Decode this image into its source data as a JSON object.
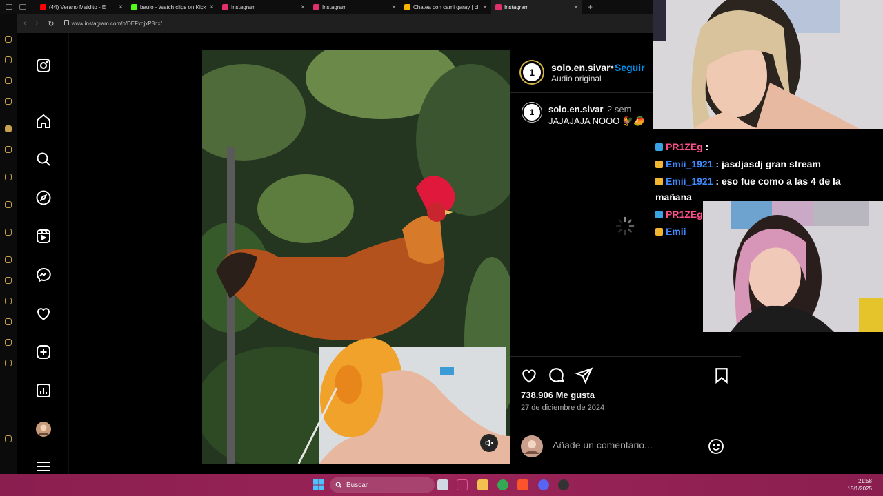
{
  "browser": {
    "tabs": [
      {
        "title": "(44) Verano Maldito - E",
        "favicon_color": "#ff0000"
      },
      {
        "title": "baulo - Watch clips on Kick",
        "favicon_color": "#53fc18"
      },
      {
        "title": "Instagram",
        "favicon_color": "#e1306c"
      },
      {
        "title": "Instagram",
        "favicon_color": "#e1306c"
      },
      {
        "title": "Chatea con cami garay | cl",
        "favicon_color": "#f7b500"
      },
      {
        "title": "Instagram",
        "favicon_color": "#e1306c"
      }
    ],
    "active_tab": 5,
    "url": "www.instagram.com/p/DEFxojxP8nx/"
  },
  "instagram": {
    "post": {
      "username": "solo.en.sivar",
      "follow_label": "Seguir",
      "separator": "•",
      "audio": "Audio original",
      "caption_user": "solo.en.sivar",
      "caption_time": "2 sem",
      "caption_text": "JAJAJAJA NOOO 🐓🥭",
      "likes": "738.906 Me gusta",
      "date": "27 de diciembre de 2024",
      "comment_placeholder": "Añade un comentario..."
    }
  },
  "stream_chat": [
    {
      "user": "PR1ZEg",
      "text": ":",
      "color": "#ff4f8b",
      "badge": "#3aa3e3"
    },
    {
      "user": "Emii_1921",
      "text": ": jasdjasdj gran stream",
      "color": "#3d8bff",
      "badge": "#f2b632"
    },
    {
      "user": "Emii_1921",
      "text": ": eso fue como a las 4 de la mañana",
      "color": "#3d8bff",
      "badge": "#f2b632"
    },
    {
      "user": "PR1ZEg",
      "text": "",
      "color": "#ff4f8b",
      "badge": "#3aa3e3"
    },
    {
      "user": "Emii_",
      "text": "",
      "color": "#3d8bff",
      "badge": "#f2b632"
    }
  ],
  "taskbar": {
    "search_label": "Buscar",
    "time": "21:58",
    "date": "15/1/2025",
    "accent": "#9b2458"
  },
  "colors": {
    "instagram_blue": "#0095f6",
    "opera_gold": "#c7a24e",
    "ig_background": "#000000"
  }
}
